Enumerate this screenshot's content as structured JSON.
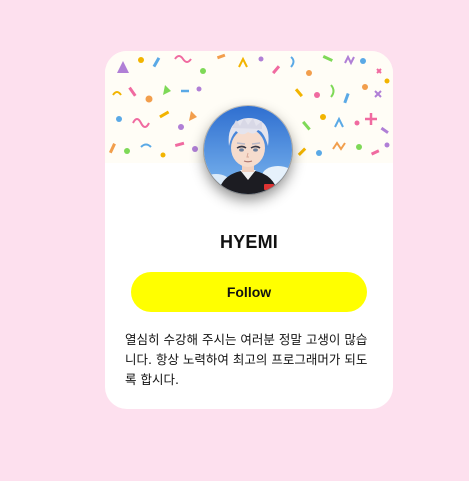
{
  "profile": {
    "name": "HYEMI",
    "follow_label": "Follow",
    "bio": "열심히 수강해 주시는 여러분 정말 고생이 많습니다. 항상 노력하여 최고의 프로그래머가 되도록 합시다."
  },
  "colors": {
    "page_background": "#fde0ee",
    "card_background": "#ffffff",
    "follow_button": "#ffff00"
  },
  "cover": {
    "pattern": "confetti"
  },
  "avatar": {
    "icon": "anime-character-avatar"
  }
}
